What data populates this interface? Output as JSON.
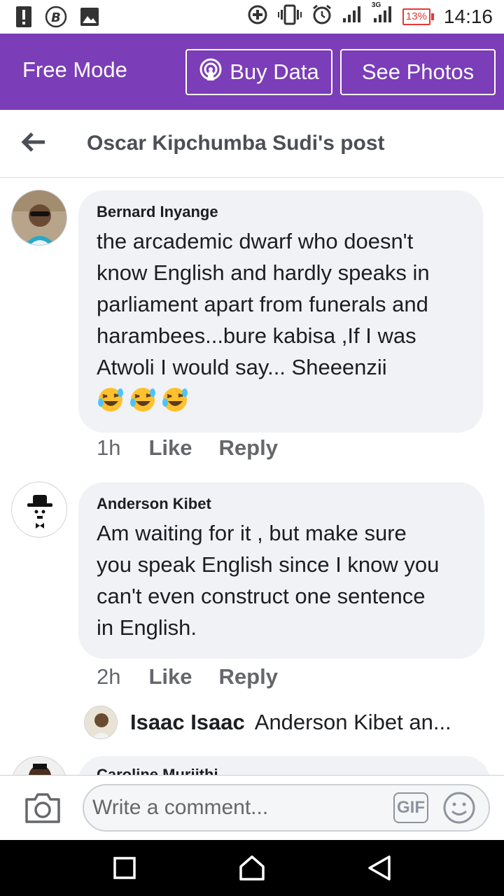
{
  "status_bar": {
    "time": "14:16",
    "battery": "13%",
    "network_label": "3G",
    "icons": [
      "alert-icon",
      "b-icon",
      "image-icon",
      "data-saver-icon",
      "vibrate-icon",
      "alarm-icon",
      "signal-icon",
      "signal-3g-icon",
      "battery-icon"
    ]
  },
  "banner": {
    "title": "Free Mode",
    "buy_data": "Buy Data",
    "see_photos": "See Photos",
    "background": "#7b3db8"
  },
  "header": {
    "title": "Oscar Kipchumba Sudi's post"
  },
  "comments": [
    {
      "author": "Bernard Inyange",
      "lines": [
        "the arcademic dwarf who doesn't",
        "know English and hardly speaks in",
        "parliament apart from funerals and",
        "harambees...bure kabisa ,If I was",
        "Atwoli I would say... Sheeenzii"
      ],
      "emoji_count": 3,
      "time": "1h",
      "like": "Like",
      "reply": "Reply"
    },
    {
      "author": "Anderson Kibet",
      "lines": [
        "Am waiting for it , but make sure",
        "you speak English since I know you",
        "can't even construct one sentence",
        "in English."
      ],
      "time": "2h",
      "like": "Like",
      "reply": "Reply"
    }
  ],
  "reply_preview": {
    "author": "Isaac Isaac",
    "text": "Anderson Kibet an..."
  },
  "partial_comment": {
    "author": "Caroline Muriithi"
  },
  "composer": {
    "placeholder": "Write a comment...",
    "gif_label": "GIF"
  }
}
